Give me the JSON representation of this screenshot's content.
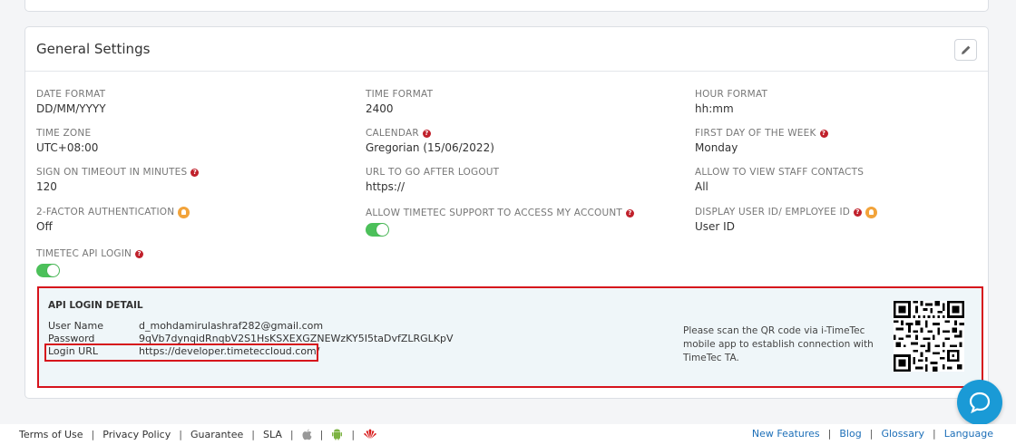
{
  "settings": {
    "title": "General Settings",
    "fields": {
      "date_format": {
        "label": "DATE FORMAT",
        "value": "DD/MM/YYYY"
      },
      "time_format": {
        "label": "TIME FORMAT",
        "value": "2400"
      },
      "hour_format": {
        "label": "HOUR FORMAT",
        "value": "hh:mm"
      },
      "time_zone": {
        "label": "TIME ZONE",
        "value": "UTC+08:00"
      },
      "calendar": {
        "label": "CALENDAR",
        "value": "Gregorian (15/06/2022)"
      },
      "first_day": {
        "label": "FIRST DAY OF THE WEEK",
        "value": "Monday"
      },
      "sign_on_timeout": {
        "label": "SIGN ON TIMEOUT IN MINUTES",
        "value": "120"
      },
      "url_after_logout": {
        "label": "URL TO GO AFTER LOGOUT",
        "value": "https://"
      },
      "view_staff_contacts": {
        "label": "ALLOW TO VIEW STAFF CONTACTS",
        "value": "All"
      },
      "two_factor": {
        "label": "2-FACTOR AUTHENTICATION",
        "value": "Off"
      },
      "timetec_support": {
        "label": "ALLOW TIMETEC SUPPORT TO ACCESS MY ACCOUNT",
        "enabled": true
      },
      "display_user_id": {
        "label": "DISPLAY USER ID/ EMPLOYEE ID",
        "value": "User ID"
      },
      "api_login": {
        "label": "TIMETEC API LOGIN",
        "enabled": true
      }
    }
  },
  "api_detail": {
    "title": "API LOGIN DETAIL",
    "user_name_label": "User Name",
    "user_name": "d_mohdamirulashraf282@gmail.com",
    "password_label": "Password",
    "password": "9qVb7dynqidRnqbV2S1HsKSXEXGZNEWzKY5I5taDvfZLRGLKpV",
    "login_url_label": "Login URL",
    "login_url": "https://developer.timeteccloud.com/",
    "qr_message": "Please scan the QR code via i-TimeTec mobile app to establish connection with TimeTec TA."
  },
  "footer": {
    "terms": "Terms of Use",
    "privacy": "Privacy Policy",
    "guarantee": "Guarantee",
    "sla": "SLA",
    "new_features": "New Features",
    "blog": "Blog",
    "glossary": "Glossary",
    "language": "Language",
    "separator": "|"
  },
  "icons": {
    "edit": "pencil-icon",
    "help": "question-icon",
    "tip": "lightbulb-icon",
    "chat": "chat-icon",
    "apple": "apple-icon",
    "android": "android-icon",
    "huawei": "huawei-icon"
  },
  "colors": {
    "toggle_on": "#4cc05a",
    "highlight": "#d6131c",
    "link": "#1d6fb8",
    "chat": "#1a9ad6"
  }
}
